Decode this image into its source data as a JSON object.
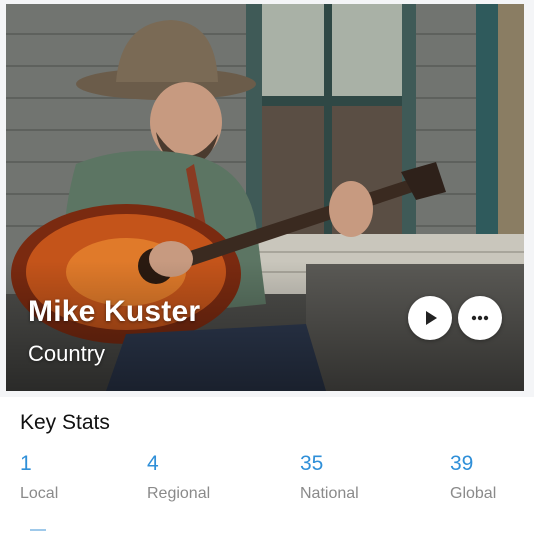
{
  "artist": {
    "name": "Mike Kuster",
    "genre": "Country"
  },
  "actions": {
    "play_icon": "play-icon",
    "more_icon": "more-horizontal-icon"
  },
  "key_stats": {
    "title": "Key Stats",
    "items": [
      {
        "value": "1",
        "label": "Local"
      },
      {
        "value": "4",
        "label": "Regional"
      },
      {
        "value": "35",
        "label": "National"
      },
      {
        "value": "39",
        "label": "Global"
      }
    ]
  },
  "colors": {
    "accent": "#2f8fd8",
    "label_gray": "#8a8a8a"
  }
}
